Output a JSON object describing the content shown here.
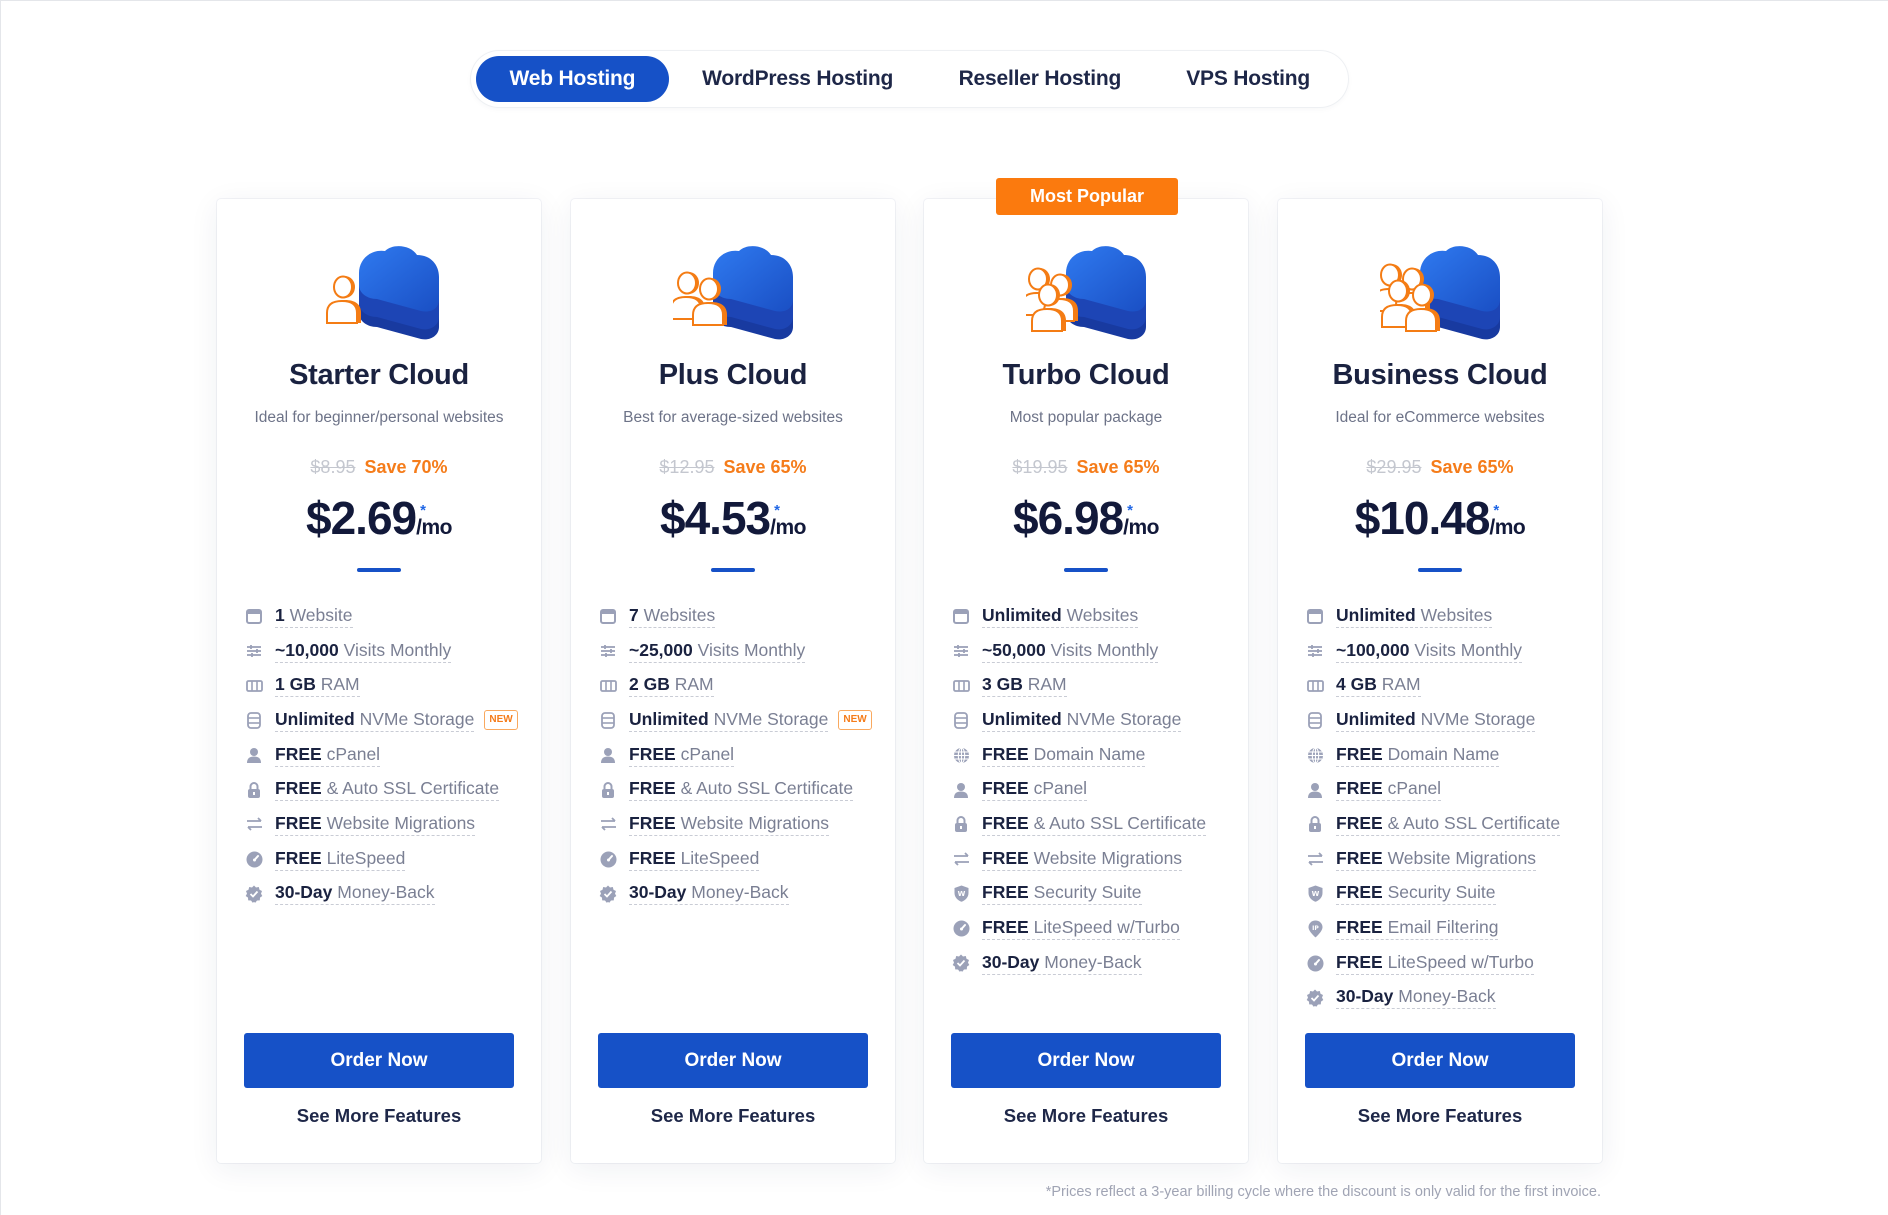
{
  "tabs": [
    {
      "label": "Web Hosting",
      "active": true
    },
    {
      "label": "WordPress Hosting",
      "active": false
    },
    {
      "label": "Reseller Hosting",
      "active": false
    },
    {
      "label": "VPS Hosting",
      "active": false
    }
  ],
  "colors": {
    "primary": "#1651c7",
    "accent": "#fb7a0e",
    "save": "#f57c1a",
    "heading": "#1a2240",
    "muted": "#7a7f93"
  },
  "plans": [
    {
      "name": "Starter Cloud",
      "description": "Ideal for beginner/personal websites",
      "old_price": "$8.95",
      "save": "Save 70%",
      "price": "$2.69",
      "asterisk": "*",
      "per": "/mo",
      "illustration": "cloud-one-user-icon",
      "features": [
        {
          "icon": "browser-window-icon",
          "bold": "1",
          "text": "Website"
        },
        {
          "icon": "sliders-icon",
          "bold": "~10,000",
          "text": "Visits Monthly"
        },
        {
          "icon": "memory-chip-icon",
          "bold": "1 GB",
          "text": "RAM"
        },
        {
          "icon": "storage-icon",
          "bold": "Unlimited",
          "text": "NVMe Storage",
          "badge": "NEW"
        },
        {
          "icon": "user-icon",
          "bold": "FREE",
          "text": "cPanel"
        },
        {
          "icon": "lock-icon",
          "bold": "FREE",
          "text": "& Auto SSL Certificate"
        },
        {
          "icon": "transfer-arrows-icon",
          "bold": "FREE",
          "text": "Website Migrations"
        },
        {
          "icon": "speedometer-icon",
          "bold": "FREE",
          "text": "LiteSpeed"
        },
        {
          "icon": "guarantee-badge-icon",
          "bold": "30-Day",
          "text": "Money-Back"
        }
      ],
      "order_label": "Order Now",
      "more_label": "See More Features"
    },
    {
      "name": "Plus Cloud",
      "description": "Best for average-sized websites",
      "old_price": "$12.95",
      "save": "Save 65%",
      "price": "$4.53",
      "asterisk": "*",
      "per": "/mo",
      "illustration": "cloud-two-users-icon",
      "features": [
        {
          "icon": "browser-window-icon",
          "bold": "7",
          "text": "Websites"
        },
        {
          "icon": "sliders-icon",
          "bold": "~25,000",
          "text": "Visits Monthly"
        },
        {
          "icon": "memory-chip-icon",
          "bold": "2 GB",
          "text": "RAM"
        },
        {
          "icon": "storage-icon",
          "bold": "Unlimited",
          "text": "NVMe Storage",
          "badge": "NEW"
        },
        {
          "icon": "user-icon",
          "bold": "FREE",
          "text": "cPanel"
        },
        {
          "icon": "lock-icon",
          "bold": "FREE",
          "text": "& Auto SSL Certificate"
        },
        {
          "icon": "transfer-arrows-icon",
          "bold": "FREE",
          "text": "Website Migrations"
        },
        {
          "icon": "speedometer-icon",
          "bold": "FREE",
          "text": "LiteSpeed"
        },
        {
          "icon": "guarantee-badge-icon",
          "bold": "30-Day",
          "text": "Money-Back"
        }
      ],
      "order_label": "Order Now",
      "more_label": "See More Features"
    },
    {
      "name": "Turbo Cloud",
      "description": "Most popular package",
      "badge": "Most Popular",
      "old_price": "$19.95",
      "save": "Save 65%",
      "price": "$6.98",
      "asterisk": "*",
      "per": "/mo",
      "illustration": "cloud-three-users-icon",
      "features": [
        {
          "icon": "browser-window-icon",
          "bold": "Unlimited",
          "text": "Websites"
        },
        {
          "icon": "sliders-icon",
          "bold": "~50,000",
          "text": "Visits Monthly"
        },
        {
          "icon": "memory-chip-icon",
          "bold": "3 GB",
          "text": "RAM"
        },
        {
          "icon": "storage-icon",
          "bold": "Unlimited",
          "text": "NVMe Storage"
        },
        {
          "icon": "globe-icon",
          "bold": "FREE",
          "text": "Domain Name"
        },
        {
          "icon": "user-icon",
          "bold": "FREE",
          "text": "cPanel"
        },
        {
          "icon": "lock-icon",
          "bold": "FREE",
          "text": "& Auto SSL Certificate"
        },
        {
          "icon": "transfer-arrows-icon",
          "bold": "FREE",
          "text": "Website Migrations"
        },
        {
          "icon": "shield-icon",
          "bold": "FREE",
          "text": "Security Suite"
        },
        {
          "icon": "speedometer-icon",
          "bold": "FREE",
          "text": "LiteSpeed w/Turbo"
        },
        {
          "icon": "guarantee-badge-icon",
          "bold": "30-Day",
          "text": "Money-Back"
        }
      ],
      "order_label": "Order Now",
      "more_label": "See More Features"
    },
    {
      "name": "Business Cloud",
      "description": "Ideal for eCommerce websites",
      "old_price": "$29.95",
      "save": "Save 65%",
      "price": "$10.48",
      "asterisk": "*",
      "per": "/mo",
      "illustration": "cloud-four-users-icon",
      "features": [
        {
          "icon": "browser-window-icon",
          "bold": "Unlimited",
          "text": "Websites"
        },
        {
          "icon": "sliders-icon",
          "bold": "~100,000",
          "text": "Visits Monthly"
        },
        {
          "icon": "memory-chip-icon",
          "bold": "4 GB",
          "text": "RAM"
        },
        {
          "icon": "storage-icon",
          "bold": "Unlimited",
          "text": "NVMe Storage"
        },
        {
          "icon": "globe-icon",
          "bold": "FREE",
          "text": "Domain Name"
        },
        {
          "icon": "user-icon",
          "bold": "FREE",
          "text": "cPanel"
        },
        {
          "icon": "lock-icon",
          "bold": "FREE",
          "text": "& Auto SSL Certificate"
        },
        {
          "icon": "transfer-arrows-icon",
          "bold": "FREE",
          "text": "Website Migrations"
        },
        {
          "icon": "shield-icon",
          "bold": "FREE",
          "text": "Security Suite"
        },
        {
          "icon": "ip-pin-icon",
          "bold": "FREE",
          "text": "Email Filtering"
        },
        {
          "icon": "speedometer-icon",
          "bold": "FREE",
          "text": "LiteSpeed w/Turbo"
        },
        {
          "icon": "guarantee-badge-icon",
          "bold": "30-Day",
          "text": "Money-Back"
        }
      ],
      "order_label": "Order Now",
      "more_label": "See More Features"
    }
  ],
  "footnote": "*Prices reflect a 3-year billing cycle where the discount is only valid for the first invoice."
}
